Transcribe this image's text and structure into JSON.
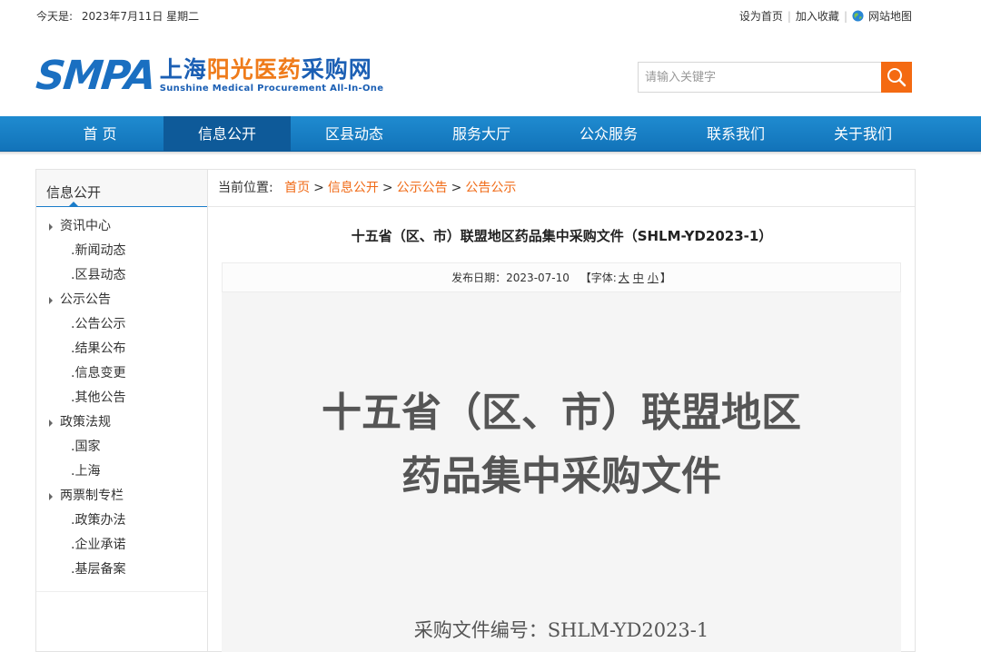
{
  "topbar": {
    "date_label": "今天是:",
    "date_value": "2023年7月11日 星期二",
    "links": [
      "设为首页",
      "加入收藏",
      "网站地图"
    ]
  },
  "logo": {
    "abbr": "SMPA",
    "cn_part1": "上海",
    "cn_part2": "阳光医药",
    "cn_part3": "采购网",
    "en": "Sunshine Medical Procurement All-In-One"
  },
  "search": {
    "placeholder": "请输入关键字"
  },
  "nav": {
    "items": [
      "首 页",
      "信息公开",
      "区县动态",
      "服务大厅",
      "公众服务",
      "联系我们",
      "关于我们"
    ],
    "active_index": 1
  },
  "sidebar": {
    "title": "信息公开",
    "items": [
      {
        "label": "资讯中心",
        "type": "cat"
      },
      {
        "label": ".新闻动态",
        "type": "sub"
      },
      {
        "label": ".区县动态",
        "type": "sub"
      },
      {
        "label": "公示公告",
        "type": "cat"
      },
      {
        "label": ".公告公示",
        "type": "sub"
      },
      {
        "label": ".结果公布",
        "type": "sub"
      },
      {
        "label": ".信息变更",
        "type": "sub"
      },
      {
        "label": ".其他公告",
        "type": "sub"
      },
      {
        "label": "政策法规",
        "type": "cat"
      },
      {
        "label": ".国家",
        "type": "sub"
      },
      {
        "label": ".上海",
        "type": "sub"
      },
      {
        "label": "两票制专栏",
        "type": "cat"
      },
      {
        "label": ".政策办法",
        "type": "sub"
      },
      {
        "label": ".企业承诺",
        "type": "sub"
      },
      {
        "label": ".基层备案",
        "type": "sub"
      }
    ]
  },
  "breadcrumb": {
    "label": "当前位置:",
    "items": [
      "首页",
      "信息公开",
      "公示公告",
      "公告公示"
    ],
    "separator": ">"
  },
  "article": {
    "title": "十五省（区、市）联盟地区药品集中采购文件（SHLM-YD2023-1）",
    "date_label": "发布日期：",
    "date_value": "2023-07-10",
    "font_prefix": "【字体:",
    "font_sizes": [
      "大",
      "中",
      "小"
    ],
    "font_suffix": "】",
    "doc_line1": "十五省（区、市）联盟地区",
    "doc_line2": "药品集中采购文件",
    "doc_number": "采购文件编号：SHLM-YD2023-1"
  },
  "colors": {
    "brand_blue": "#1a6fc1",
    "nav_blue": "#1a80c6",
    "nav_active": "#0e5a99",
    "accent_orange": "#f06a16"
  }
}
